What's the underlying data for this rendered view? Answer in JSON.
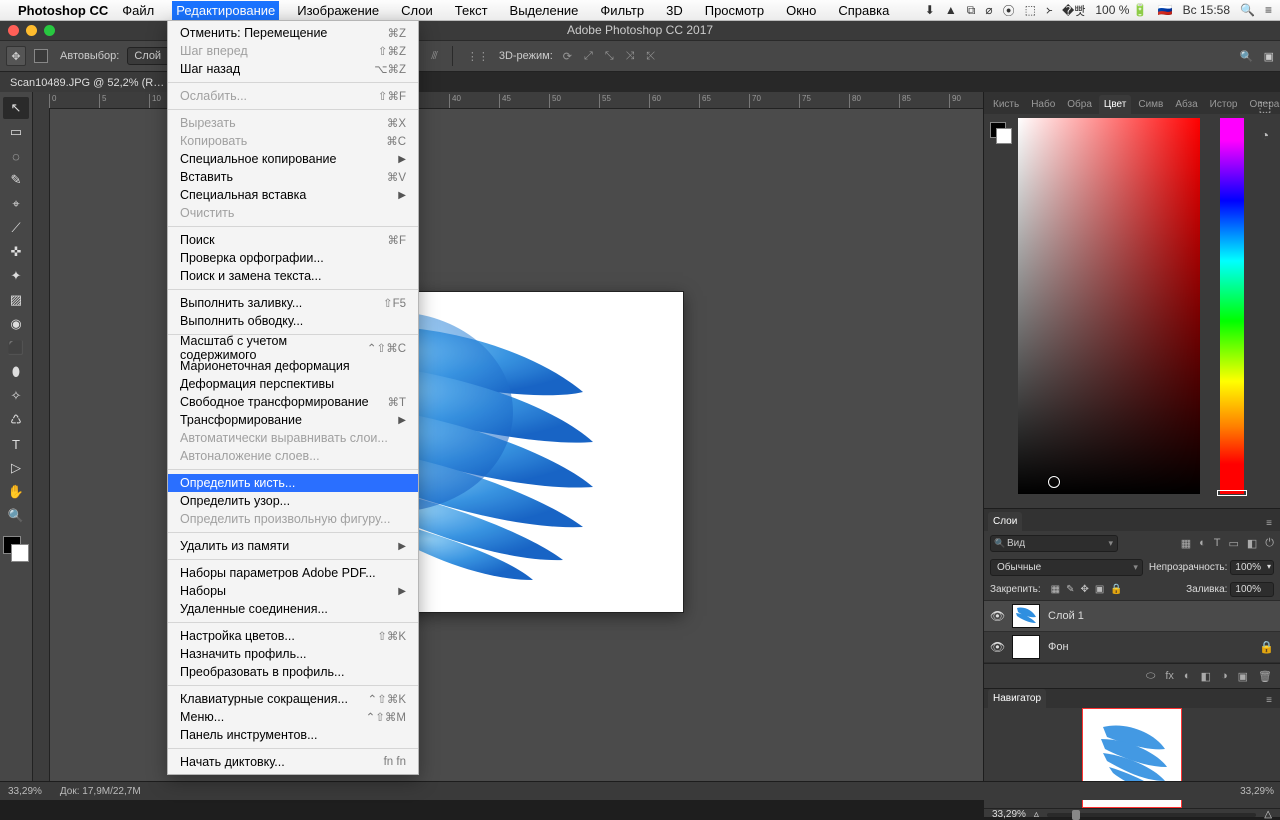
{
  "menubar": {
    "app": "Photoshop CC",
    "items": [
      "Файл",
      "Редактирование",
      "Изображение",
      "Слои",
      "Текст",
      "Выделение",
      "Фильтр",
      "3D",
      "Просмотр",
      "Окно",
      "Справка"
    ],
    "active": "Редактирование",
    "tray": {
      "battery": "100 %",
      "flag": "🇷🇺",
      "day": "Вс",
      "time": "15:58"
    }
  },
  "window": {
    "title": "Adobe Photoshop CC 2017"
  },
  "doc_tab": {
    "label": "Scan10489.JPG @ 52,2% (R…"
  },
  "options": {
    "autoselect_label": "Автовыбор:",
    "autoselect_value": "Слой",
    "mode3d": "3D-режим:"
  },
  "dropdown": {
    "groups": [
      [
        {
          "label": "Отменить: Перемещение",
          "shortcut": "⌘Z"
        },
        {
          "label": "Шаг вперед",
          "shortcut": "⇧⌘Z",
          "disabled": true
        },
        {
          "label": "Шаг назад",
          "shortcut": "⌥⌘Z"
        }
      ],
      [
        {
          "label": "Ослабить...",
          "shortcut": "⇧⌘F",
          "disabled": true
        }
      ],
      [
        {
          "label": "Вырезать",
          "shortcut": "⌘X",
          "disabled": true
        },
        {
          "label": "Копировать",
          "shortcut": "⌘C",
          "disabled": true
        },
        {
          "label": "Специальное копирование",
          "submenu": true
        },
        {
          "label": "Вставить",
          "shortcut": "⌘V"
        },
        {
          "label": "Специальная вставка",
          "submenu": true
        },
        {
          "label": "Очистить",
          "disabled": true
        }
      ],
      [
        {
          "label": "Поиск",
          "shortcut": "⌘F"
        },
        {
          "label": "Проверка орфографии..."
        },
        {
          "label": "Поиск и замена текста..."
        }
      ],
      [
        {
          "label": "Выполнить заливку...",
          "shortcut": "⇧F5"
        },
        {
          "label": "Выполнить обводку..."
        }
      ],
      [
        {
          "label": "Масштаб с учетом содержимого",
          "shortcut": "⌃⇧⌘C"
        },
        {
          "label": "Марионеточная деформация"
        },
        {
          "label": "Деформация перспективы"
        },
        {
          "label": "Свободное трансформирование",
          "shortcut": "⌘T"
        },
        {
          "label": "Трансформирование",
          "submenu": true
        },
        {
          "label": "Автоматически выравнивать слои...",
          "disabled": true
        },
        {
          "label": "Автоналожение слоев...",
          "disabled": true
        }
      ],
      [
        {
          "label": "Определить кисть...",
          "highlight": true
        },
        {
          "label": "Определить узор..."
        },
        {
          "label": "Определить произвольную фигуру...",
          "disabled": true
        }
      ],
      [
        {
          "label": "Удалить из памяти",
          "submenu": true
        }
      ],
      [
        {
          "label": "Наборы параметров Adobe PDF..."
        },
        {
          "label": "Наборы",
          "submenu": true
        },
        {
          "label": "Удаленные соединения..."
        }
      ],
      [
        {
          "label": "Настройка цветов...",
          "shortcut": "⇧⌘K"
        },
        {
          "label": "Назначить профиль..."
        },
        {
          "label": "Преобразовать в профиль..."
        }
      ],
      [
        {
          "label": "Клавиатурные сокращения...",
          "shortcut": "⌃⇧⌘K"
        },
        {
          "label": "Меню...",
          "shortcut": "⌃⇧⌘M"
        },
        {
          "label": "Панель инструментов..."
        }
      ],
      [
        {
          "label": "Начать диктовку...",
          "shortcut": "fn fn"
        }
      ]
    ]
  },
  "panels": {
    "color": {
      "tabs": [
        "Кисть",
        "Набо",
        "Обра",
        "Цвет",
        "Симв",
        "Абза",
        "Истор",
        "Опера"
      ],
      "active": "Цвет"
    },
    "layers": {
      "title": "Слои",
      "filter_label": "Вид",
      "blend_mode": "Обычные",
      "opacity_label": "Непрозрачность:",
      "opacity_value": "100%",
      "lock_label": "Закрепить:",
      "fill_label": "Заливка:",
      "fill_value": "100%",
      "items": [
        {
          "name": "Слой 1",
          "selected": true
        },
        {
          "name": "Фон",
          "locked": true
        }
      ],
      "footer_icons": [
        "⬭",
        "fx",
        "◐",
        "◧",
        "◑",
        "▣",
        "🗑"
      ]
    },
    "navigator": {
      "title": "Навигатор",
      "zoom": "33,29%"
    }
  },
  "status": {
    "zoom": "33,29%",
    "doc": "Док: 17,9M/22,7M",
    "zoom_right": "33,29%"
  },
  "tools": [
    "↖",
    "▭",
    "◌",
    "✎",
    "⌖",
    "⟋",
    "✜",
    "✦",
    "▨",
    "◉",
    "⬛",
    "⬮",
    "✧",
    "♺",
    "T",
    "▷",
    "✋",
    "🔍"
  ]
}
